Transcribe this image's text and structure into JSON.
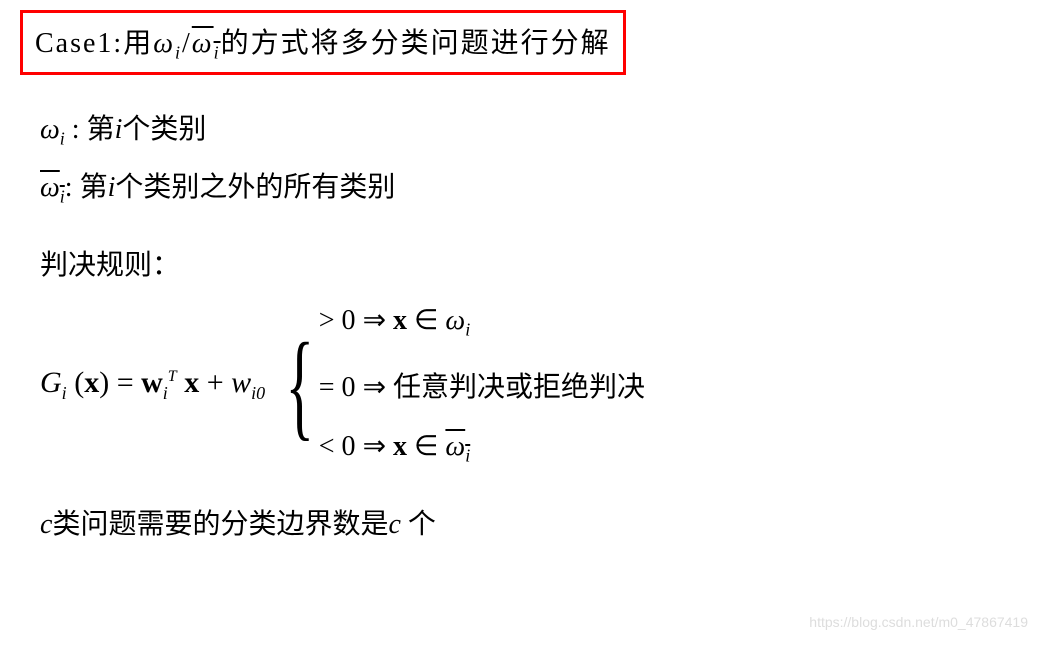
{
  "title": {
    "prefix": "Case1:用",
    "omega1": "ω",
    "sub_i": "i",
    "slash": "/",
    "omega2": "ω",
    "suffix": "的方式将多分类问题进行分解"
  },
  "def1": {
    "omega": "ω",
    "sub": "i",
    "colon": " : 第",
    "i": "i",
    "text": "个类别"
  },
  "def2": {
    "omega": "ω",
    "sub": "i",
    "colon": ": 第",
    "i": "i",
    "text": "个类别之外的所有类别"
  },
  "rule_label": "判决规则：",
  "formula": {
    "G": "G",
    "sub_i": "i",
    "lparen": " (",
    "x": "x",
    "rparen": ") ",
    "eq": "= ",
    "w": "w",
    "sup_T": "T",
    "w2": "w",
    "sub_i0": "i0",
    "plus": " + "
  },
  "cases": {
    "c1_op": "> 0 ",
    "arrow": "⇒",
    "c1_x": " x ",
    "c1_in": "∈ ",
    "c1_omega": "ω",
    "c1_sub": "i",
    "c2_op": "= 0 ",
    "c2_text": " 任意判决或拒绝判决",
    "c3_op": "< 0 ",
    "c3_x": " x ",
    "c3_in": "∈ ",
    "c3_omega": "ω",
    "c3_sub": "i"
  },
  "footer": {
    "c1": "c",
    "text1": "类问题需要的分类边界数是",
    "c2": "c",
    "text2": " 个"
  },
  "watermark": "https://blog.csdn.net/m0_47867419"
}
